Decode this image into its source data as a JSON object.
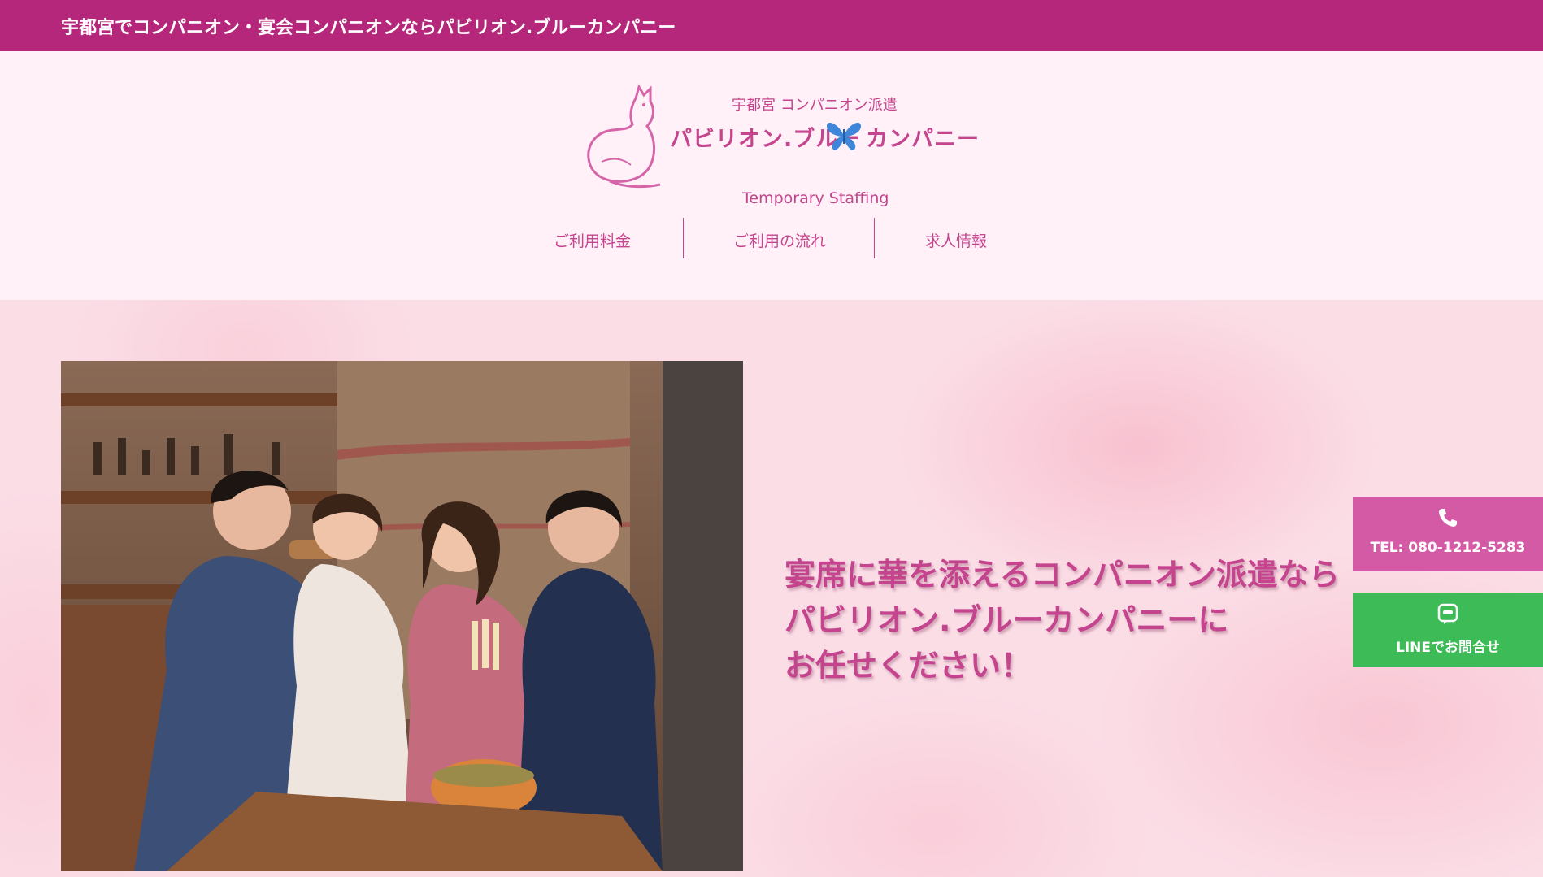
{
  "topbar": {
    "text": "宇都宮でコンパニオン・宴会コンパニオンならパビリオン.ブルーカンパニー"
  },
  "logo": {
    "top": "宇都宮 コンパニオン派遣",
    "main_left": "パビリオン.ブルー",
    "main_right": "カンパニー",
    "sub": "Temporary Staffing"
  },
  "nav": {
    "items": [
      {
        "label": "ご利用料金"
      },
      {
        "label": "ご利用の流れ"
      },
      {
        "label": "求人情報"
      }
    ]
  },
  "hero": {
    "tagline": [
      "宴席に華を添えるコンパニオン派遣なら",
      "パビリオン.ブルーカンパニーに",
      "お任せください！"
    ]
  },
  "side_buttons": {
    "tel": {
      "label": "TEL: 080-1212-5283",
      "icon": "phone-icon"
    },
    "line": {
      "label": "LINEでお問合せ",
      "icon": "line-chat-icon"
    }
  },
  "colors": {
    "brand": "#b5277a",
    "accent": "#c4448e",
    "tel_button": "#d55aa6",
    "line_button": "#3dbb57",
    "header_bg": "#fff1f7"
  }
}
